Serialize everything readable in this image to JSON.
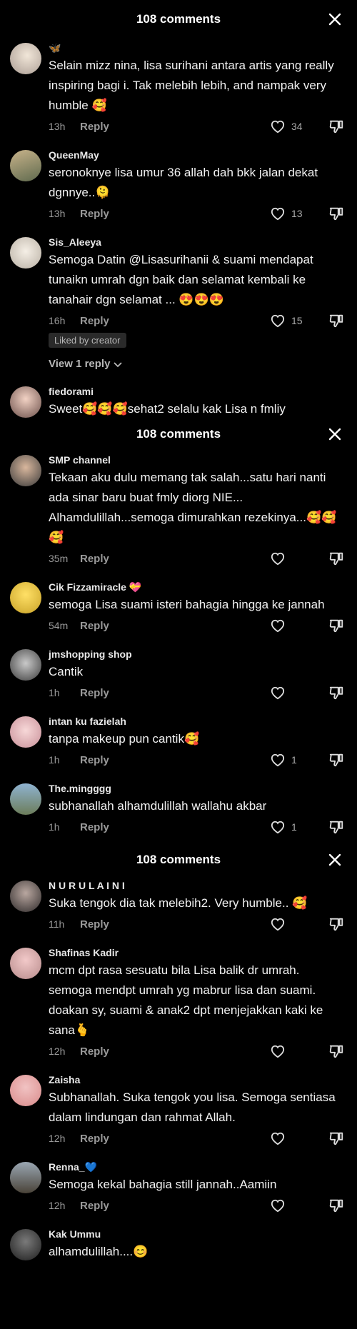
{
  "panels": [
    {
      "title": "108 comments"
    },
    {
      "title": "108 comments"
    },
    {
      "title": "108 comments"
    }
  ],
  "comments": [
    {
      "username": "🦋",
      "text": "Selain mizz nina, lisa surihani antara artis yang really inspiring bagi i. Tak melebih lebih, and nampak very humble 🥰",
      "time": "13h",
      "likes": "34"
    },
    {
      "username": "QueenMay",
      "text": "seronoknye lisa umur 36 allah dah bkk jalan dekat dgnnye..🫠",
      "time": "13h",
      "likes": "13"
    },
    {
      "username": "Sis_Aleeya",
      "text": "Semoga Datin @Lisasurihanii & suami mendapat tunaikn umrah dgn baik dan selamat kembali ke tanahair dgn selamat ... 😍😍😍",
      "time": "16h",
      "likes": "15",
      "badge": "Liked by creator",
      "view_reply": "View 1 reply"
    },
    {
      "username": "fiedorami",
      "text": "Sweet🥰🥰🥰sehat2 selalu kak Lisa n fmliy"
    },
    {
      "username": "SMP channel",
      "text": "Tekaan aku dulu memang tak salah...satu hari nanti ada sinar baru buat fmly diorg NIE... Alhamdulillah...semoga dimurahkan rezekinya...🥰🥰🥰",
      "time": "35m"
    },
    {
      "username": "Cik Fizzamiracle 💝",
      "text": "semoga Lisa suami isteri bahagia hingga ke jannah",
      "time": "54m"
    },
    {
      "username": "jmshopping shop",
      "text": "Cantik",
      "time": "1h"
    },
    {
      "username": "intan ku fazielah",
      "text": "tanpa makeup pun cantik🥰",
      "time": "1h",
      "likes": "1"
    },
    {
      "username": "The.mingggg",
      "text": "subhanallah alhamdulillah wallahu akbar",
      "time": "1h",
      "likes": "1"
    },
    {
      "username": "N U R U L A I N I",
      "text": "Suka tengok dia tak melebih2. Very humble.. 🥰",
      "time": "11h"
    },
    {
      "username": "Shafinas Kadir",
      "text": "mcm dpt rasa sesuatu bila Lisa balik dr umrah. semoga mendpt umrah yg mabrur lisa dan suami. doakan sy, suami & anak2 dpt menjejakkan kaki ke sana🫰",
      "time": "12h"
    },
    {
      "username": "Zaisha",
      "text": "Subhanallah. Suka tengok you lisa. Semoga sentiasa dalam lindungan dan rahmat Allah.",
      "time": "12h"
    },
    {
      "username": "Renna_💙",
      "text": "Semoga kekal bahagia still jannah..Aamiin",
      "time": "12h"
    },
    {
      "username": "Kak Ummu",
      "text": "alhamdulillah....😊"
    }
  ],
  "labels": {
    "reply": "Reply"
  },
  "colors": {
    "background": "#000000",
    "muted": "#9a9a9a",
    "text": "#f2f2f2"
  },
  "icons": [
    "close-icon",
    "heart-outline-icon",
    "dislike-icon",
    "chevron-down-icon"
  ]
}
